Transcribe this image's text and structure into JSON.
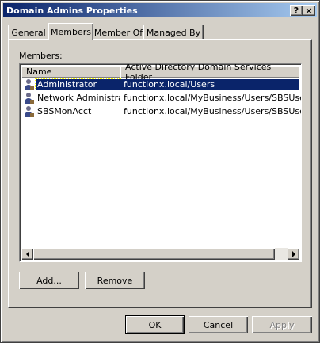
{
  "window": {
    "title": "Domain Admins Properties",
    "help_label": "?",
    "close_label": "×"
  },
  "tabs": [
    {
      "label": "General"
    },
    {
      "label": "Members"
    },
    {
      "label": "Member Of"
    },
    {
      "label": "Managed By"
    }
  ],
  "members": {
    "label": "Members:",
    "columns": {
      "name": "Name",
      "folder": "Active Directory Domain Services Folder"
    },
    "rows": [
      {
        "name": "Administrator",
        "folder": "functionx.local/Users",
        "icon": "user-icon",
        "selected": true
      },
      {
        "name": "Network Administrator",
        "folder": "functionx.local/MyBusiness/Users/SBSUsers",
        "icon": "user-icon",
        "selected": false
      },
      {
        "name": "SBSMonAcct",
        "folder": "functionx.local/MyBusiness/Users/SBSUsers",
        "icon": "user-icon",
        "selected": false
      }
    ]
  },
  "buttons": {
    "add": "Add...",
    "remove": "Remove",
    "ok": "OK",
    "cancel": "Cancel",
    "apply": "Apply"
  },
  "colors": {
    "titlebar_start": "#0a246a",
    "titlebar_end": "#a6caf0",
    "selection": "#0a246a",
    "face": "#d4d0c8"
  }
}
